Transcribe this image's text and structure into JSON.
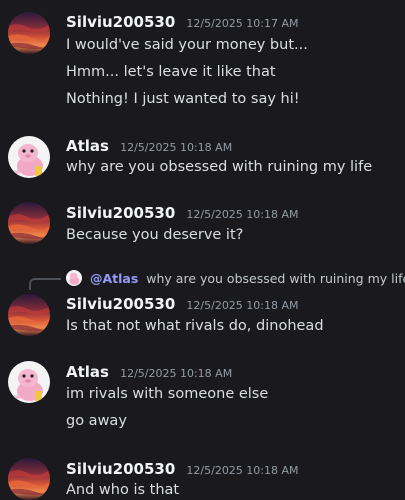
{
  "messages": [
    {
      "username": "Silviu200530",
      "timestamp": "12/5/2025 10:17 AM",
      "avatar": "sunset-sky-avatar",
      "lines": [
        "I would've said your money but...",
        "Hmm... let's leave it like that",
        "Nothing! I just wanted to say hi!"
      ]
    },
    {
      "username": "Atlas",
      "timestamp": "12/5/2025 10:18 AM",
      "avatar": "pink-dino-plush-avatar",
      "lines": [
        "why are you obsessed with ruining my life"
      ]
    },
    {
      "username": "Silviu200530",
      "timestamp": "12/5/2025 10:18 AM",
      "avatar": "sunset-sky-avatar",
      "lines": [
        "Because you deserve it?"
      ]
    },
    {
      "username": "Silviu200530",
      "timestamp": "12/5/2025 10:18 AM",
      "avatar": "sunset-sky-avatar",
      "reply": {
        "user": "@Atlas",
        "text": "why are you obsessed with ruining my life"
      },
      "lines": [
        "Is that not what rivals do, dinohead"
      ]
    },
    {
      "username": "Atlas",
      "timestamp": "12/5/2025 10:18 AM",
      "avatar": "pink-dino-plush-avatar",
      "lines": [
        "im rivals with someone else",
        "go away"
      ]
    },
    {
      "username": "Silviu200530",
      "timestamp": "12/5/2025 10:18 AM",
      "avatar": "sunset-sky-avatar",
      "lines": [
        "And who is that"
      ]
    }
  ],
  "colors": {
    "background": "#1a1a1e",
    "username": "#f2f3f5",
    "timestamp": "#949ba4",
    "message_text": "#dbdee1",
    "mention": "#949cf7"
  }
}
